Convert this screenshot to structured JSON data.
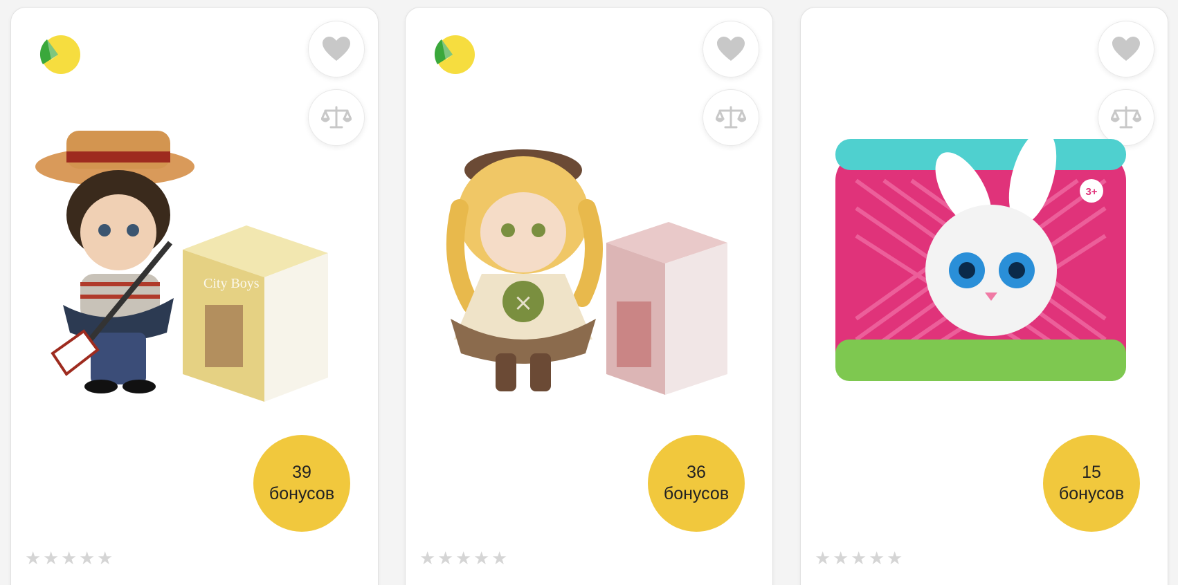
{
  "colors": {
    "badge_yellow": "#f1c83d",
    "brand_green": "#3aa83b",
    "brand_yellow": "#f6dd3f",
    "icon_gray": "#c8c8c8",
    "star_gray": "#d5d5d5"
  },
  "products": [
    {
      "image": "doll-boy-with-straw-hat-and-oar-with-city-boys-box",
      "has_brand_badge": true,
      "favorite_icon": "heart-icon",
      "compare_icon": "scales-icon",
      "bonus_amount": "39",
      "bonus_word": "бонусов",
      "rating": 0,
      "rating_max": 5
    },
    {
      "image": "blonde-doll-girl-with-button-and-pink-box",
      "has_brand_badge": true,
      "favorite_icon": "heart-icon",
      "compare_icon": "scales-icon",
      "bonus_amount": "36",
      "bonus_word": "бонусов",
      "rating": 0,
      "rating_max": 5
    },
    {
      "image": "pink-box-with-white-bunny-toy",
      "has_brand_badge": false,
      "favorite_icon": "heart-icon",
      "compare_icon": "scales-icon",
      "bonus_amount": "15",
      "bonus_word": "бонусов",
      "rating": 0,
      "rating_max": 5
    }
  ]
}
